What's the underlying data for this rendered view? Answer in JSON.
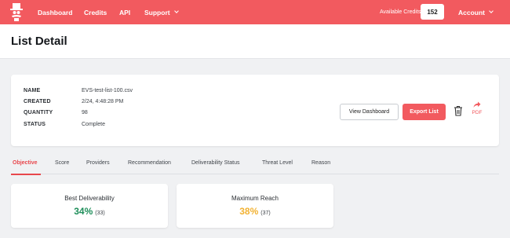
{
  "colors": {
    "brand": "#f25a5f",
    "deliverability": "#1e8e5a",
    "reach": "#f2b233"
  },
  "nav": {
    "logo": "logo-icon",
    "items": [
      {
        "label": "Dashboard"
      },
      {
        "label": "Credits"
      },
      {
        "label": "API"
      },
      {
        "label": "Support"
      }
    ],
    "available_credits_label": "Available Credits",
    "available_credits_value": "152",
    "account_label": "Account"
  },
  "page": {
    "title": "List Detail"
  },
  "detail": {
    "fields": [
      {
        "key": "NAME",
        "value": "EVS-test-list-100.csv"
      },
      {
        "key": "CREATED",
        "value": "2/24, 4:48:28 PM"
      },
      {
        "key": "QUANTITY",
        "value": "98"
      },
      {
        "key": "STATUS",
        "value": "Complete"
      }
    ],
    "view_dashboard_label": "View Dashboard",
    "export_list_label": "Export List",
    "delete_icon": "trash-icon",
    "pdf_icon": "share-arrow-icon",
    "pdf_label": "PDF"
  },
  "tabs": [
    {
      "label": "Objective",
      "active": true
    },
    {
      "label": "Score"
    },
    {
      "label": "Providers"
    },
    {
      "label": "Recommendation"
    },
    {
      "label": "Deliverability Status"
    },
    {
      "label": "Threat Level"
    },
    {
      "label": "Reason"
    }
  ],
  "metrics": [
    {
      "title": "Best Deliverability",
      "percent": "34%",
      "count": "(33)"
    },
    {
      "title": "Maximum Reach",
      "percent": "38%",
      "count": "(37)"
    }
  ]
}
